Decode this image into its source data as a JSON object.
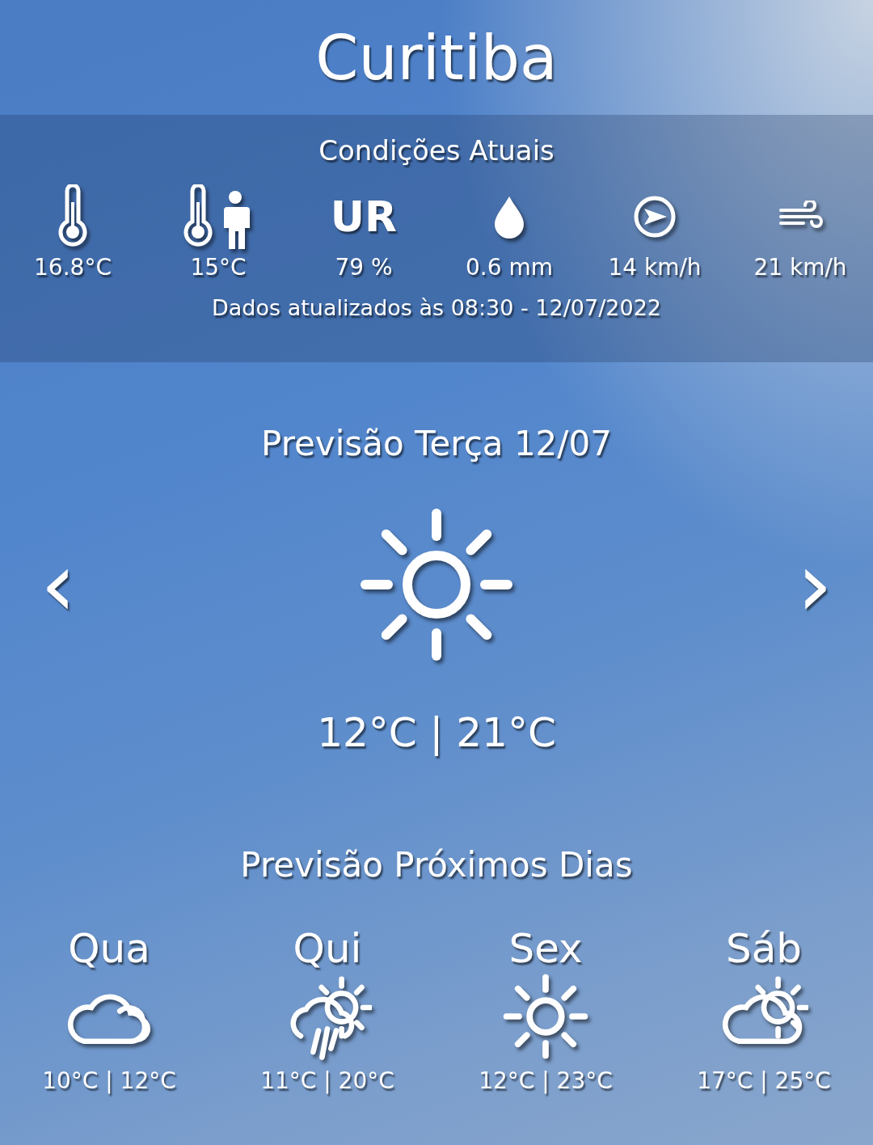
{
  "city": "Curitiba",
  "current": {
    "title": "Condições Atuais",
    "items": [
      {
        "kind": "temperature",
        "value": "16.8°C"
      },
      {
        "kind": "feels-like",
        "value": "15°C"
      },
      {
        "kind": "humidity",
        "symbol": "UR",
        "value": "79 %"
      },
      {
        "kind": "rain",
        "value": "0.6 mm"
      },
      {
        "kind": "wind-direction",
        "value": "14 km/h"
      },
      {
        "kind": "gust",
        "value": "21 km/h"
      }
    ],
    "updated": "Dados atualizados às 08:30 - 12/07/2022"
  },
  "today": {
    "title": "Previsão Terça 12/07",
    "kind": "sunny",
    "range": "12°C | 21°C",
    "prev": "‹",
    "next": "›"
  },
  "next_days": {
    "title": "Previsão Próximos Dias",
    "days": [
      {
        "day": "Qua",
        "kind": "cloudy",
        "range": "10°C | 12°C"
      },
      {
        "day": "Qui",
        "kind": "rain-sun",
        "range": "11°C | 20°C"
      },
      {
        "day": "Sex",
        "kind": "sunny",
        "range": "12°C | 23°C"
      },
      {
        "day": "Sáb",
        "kind": "partly-cloudy",
        "range": "17°C | 25°C"
      }
    ]
  }
}
